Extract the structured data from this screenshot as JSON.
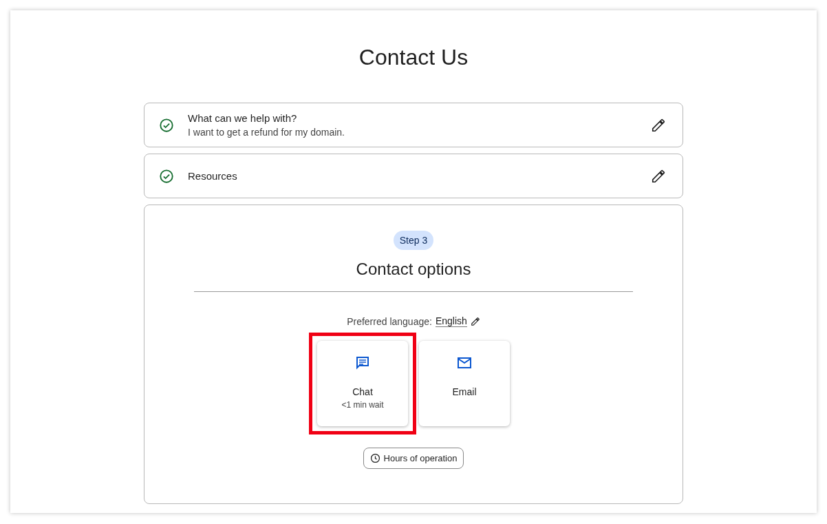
{
  "title": "Contact Us",
  "steps": [
    {
      "title": "What can we help with?",
      "summary": "I want to get a refund for my domain.",
      "completed": true
    },
    {
      "title": "Resources",
      "completed": true
    }
  ],
  "current_step": {
    "badge": "Step 3",
    "title": "Contact options",
    "language_label": "Preferred language:",
    "language": "English",
    "options": [
      {
        "kind": "chat",
        "label": "Chat",
        "detail": "<1 min wait",
        "highlighted": true
      },
      {
        "kind": "email",
        "label": "Email",
        "highlighted": false
      }
    ],
    "hours_button": "Hours of operation"
  }
}
